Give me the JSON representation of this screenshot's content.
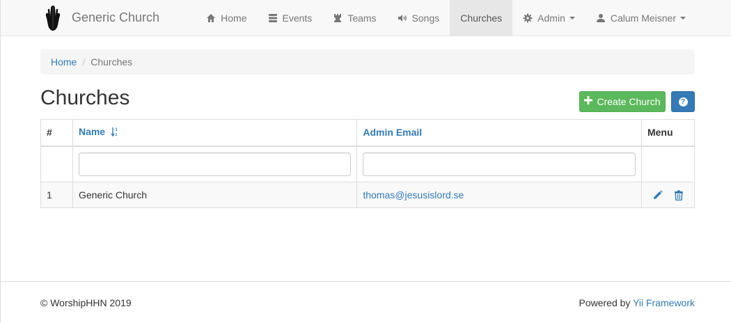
{
  "navbar": {
    "brand": "Generic Church",
    "items": [
      {
        "label": "Home",
        "icon": "home-icon"
      },
      {
        "label": "Events",
        "icon": "tasks-icon"
      },
      {
        "label": "Teams",
        "icon": "tower-icon"
      },
      {
        "label": "Songs",
        "icon": "volume-icon"
      },
      {
        "label": "Churches",
        "active": true
      },
      {
        "label": "Admin",
        "icon": "gear-icon",
        "dropdown": true
      },
      {
        "label": "Calum Meisner",
        "icon": "user-icon",
        "dropdown": true
      }
    ]
  },
  "breadcrumb": {
    "home": "Home",
    "separator": "/",
    "current": "Churches"
  },
  "page": {
    "title": "Churches",
    "create_button": "Create Church",
    "help_icon": "?"
  },
  "table": {
    "columns": {
      "num": "#",
      "name": "Name",
      "email": "Admin Email",
      "menu": "Menu"
    },
    "rows": [
      {
        "num": "1",
        "name": "Generic Church",
        "email": "thomas@jesusislord.se"
      }
    ]
  },
  "footer": {
    "copyright": "© WorshipHHN 2019",
    "powered_prefix": "Powered by ",
    "powered_link": "Yii Framework"
  },
  "colors": {
    "link": "#337ab7",
    "success": "#5cb85c",
    "primary": "#337ab7",
    "navbar_bg": "#f8f8f8",
    "active_nav": "#e7e7e7"
  }
}
